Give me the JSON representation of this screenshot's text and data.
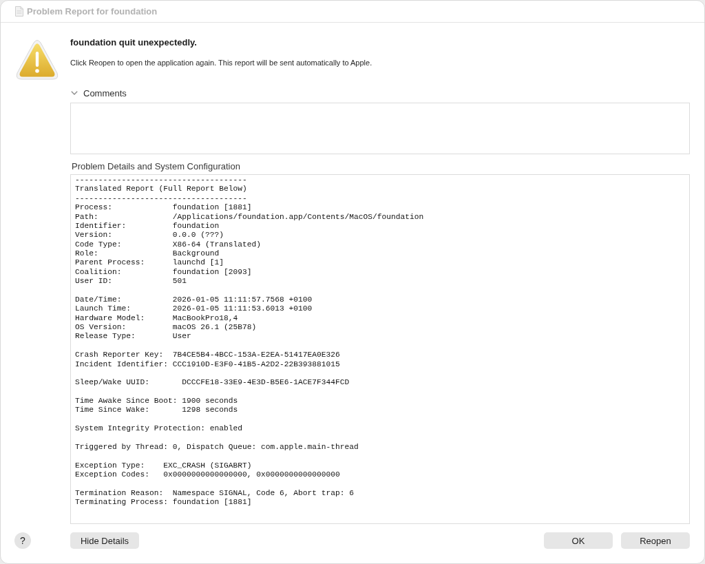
{
  "window": {
    "title": "Problem Report for foundation"
  },
  "alert": {
    "headline": "foundation quit unexpectedly.",
    "message": "Click Reopen to open the application again. This report will be sent automatically to Apple."
  },
  "comments": {
    "label": "Comments",
    "expanded": true
  },
  "details": {
    "label": "Problem Details and System Configuration",
    "report_sections": [
      [
        "-------------------------------------",
        "Translated Report (Full Report Below)",
        "-------------------------------------",
        "Process:             foundation [1881]",
        "Path:                /Applications/foundation.app/Contents/MacOS/foundation",
        "Identifier:          foundation",
        "Version:             0.0.0 (???)",
        "Code Type:           X86-64 (Translated)",
        "Role:                Background",
        "Parent Process:      launchd [1]",
        "Coalition:           foundation [2093]",
        "User ID:             501"
      ],
      [
        "Date/Time:           2026-01-05 11:11:57.7568 +0100",
        "Launch Time:         2026-01-05 11:11:53.6013 +0100",
        "Hardware Model:      MacBookPro18,4",
        "OS Version:          macOS 26.1 (25B78)",
        "Release Type:        User"
      ],
      [
        "Crash Reporter Key:  7B4CE5B4-4BCC-153A-E2EA-51417EA0E326",
        "Incident Identifier: CCC1910D-E3F0-41B5-A2D2-22B393881015"
      ],
      [
        "Sleep/Wake UUID:       DCCCFE18-33E9-4E3D-B5E6-1ACE7F344FCD"
      ],
      [
        "Time Awake Since Boot: 1900 seconds",
        "Time Since Wake:       1298 seconds"
      ],
      [
        "System Integrity Protection: enabled"
      ],
      [
        "Triggered by Thread: 0, Dispatch Queue: com.apple.main-thread"
      ],
      [
        "Exception Type:    EXC_CRASH (SIGABRT)",
        "Exception Codes:   0x0000000000000000, 0x0000000000000000"
      ],
      [
        "Termination Reason:  Namespace SIGNAL, Code 6, Abort trap: 6",
        "Terminating Process: foundation [1881]"
      ]
    ]
  },
  "footer": {
    "help": "?",
    "left_buttons": [
      {
        "label": "Hide Details"
      }
    ],
    "right_buttons": [
      {
        "label": "OK"
      },
      {
        "label": "Reopen"
      }
    ]
  }
}
